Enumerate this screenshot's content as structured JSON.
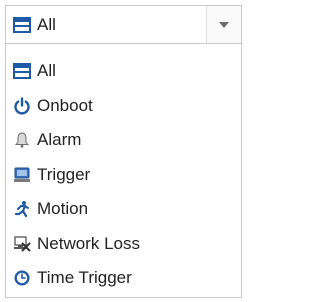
{
  "select": {
    "selected_label": "All",
    "selected_icon": "all-icon"
  },
  "options": [
    {
      "label": "All",
      "icon": "all-icon"
    },
    {
      "label": "Onboot",
      "icon": "power-icon"
    },
    {
      "label": "Alarm",
      "icon": "bell-icon"
    },
    {
      "label": "Trigger",
      "icon": "trigger-icon"
    },
    {
      "label": "Motion",
      "icon": "running-person-icon"
    },
    {
      "label": "Network Loss",
      "icon": "network-loss-icon"
    },
    {
      "label": "Time Trigger",
      "icon": "clock-icon"
    }
  ],
  "colors": {
    "icon_blue": "#1f5aa6",
    "text": "#222222",
    "border": "#c9c9c9"
  }
}
